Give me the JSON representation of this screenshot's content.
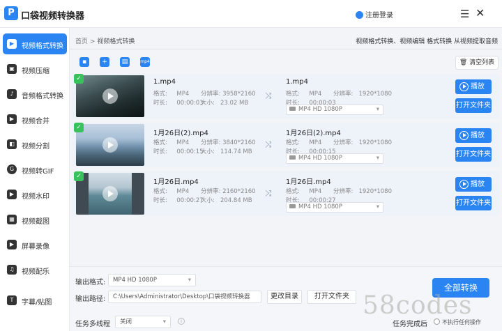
{
  "app": {
    "title": "口袋视频转换器",
    "logo_glyph": "P"
  },
  "header": {
    "login_label": "注册登录"
  },
  "sidebar": {
    "items": [
      {
        "label": "视频格式转换",
        "icon": "video-convert-icon",
        "active": true
      },
      {
        "label": "视频压缩",
        "icon": "video-compress-icon"
      },
      {
        "label": "音频格式转换",
        "icon": "audio-convert-icon"
      },
      {
        "label": "视频合并",
        "icon": "video-merge-icon"
      },
      {
        "label": "视频分割",
        "icon": "video-split-icon"
      },
      {
        "label": "视频转GIF",
        "icon": "gif-icon"
      },
      {
        "label": "视频水印",
        "icon": "watermark-icon"
      },
      {
        "label": "视频截图",
        "icon": "screenshot-icon"
      },
      {
        "label": "屏幕录像",
        "icon": "screen-record-icon"
      },
      {
        "label": "视频配乐",
        "icon": "music-icon"
      },
      {
        "label": "字幕/贴图",
        "icon": "subtitle-icon"
      }
    ]
  },
  "breadcrumb": {
    "home": "首页",
    "sep": ">",
    "current": "视频格式转换"
  },
  "tips": "视频格式转换、视频编辑 格式转换 从视频提取音频",
  "toolbar": {
    "clear_label": "清空列表",
    "tools": [
      "add-file-icon",
      "add-folder-icon",
      "output-device-icon",
      "mp4-settings-icon"
    ]
  },
  "labels": {
    "format": "格式:",
    "resolution": "分辨率:",
    "duration": "时长:",
    "size": "大小:",
    "play": "播放",
    "open_folder": "打开文件夹"
  },
  "files": [
    {
      "name": "1.mp4",
      "format": "MP4",
      "resolution": "3958*2160",
      "duration": "00:00:03",
      "size": "23.02 MB",
      "out_name": "1.mp4",
      "out_format": "MP4",
      "out_resolution": "1920*1080",
      "out_duration": "00:00:03",
      "out_preset": "MP4  HD 1080P"
    },
    {
      "name": "1月26日(2).mp4",
      "format": "MP4",
      "resolution": "3840*2160",
      "duration": "00:00:15",
      "size": "114.74 MB",
      "out_name": "1月26日(2).mp4",
      "out_format": "MP4",
      "out_resolution": "1920*1080",
      "out_duration": "00:00:15",
      "out_preset": "MP4  HD 1080P"
    },
    {
      "name": "1月26日.mp4",
      "format": "MP4",
      "resolution": "2160*2160",
      "duration": "00:00:27",
      "size": "204.84 MB",
      "out_name": "1月26日.mp4",
      "out_format": "MP4",
      "out_resolution": "1920*1080",
      "out_duration": "00:00:27",
      "out_preset": "MP4  HD 1080P"
    }
  ],
  "bottom": {
    "output_format_label": "输出格式:",
    "output_format_value": "MP4  HD 1080P",
    "output_path_label": "输出路径:",
    "output_path_value": "C:\\Users\\Administrator\\Desktop\\口袋视频转换器",
    "change_dir_label": "更改目录",
    "open_folder_label": "打开文件夹",
    "multithread_label": "任务多线程",
    "multithread_value": "关闭",
    "convert_all_label": "全部转换",
    "after_done_label": "任务完成后",
    "after_done_option": "不执行任何操作"
  },
  "watermark": "58codes",
  "colors": {
    "accent": "#2a84f2",
    "check": "#37c25c"
  }
}
